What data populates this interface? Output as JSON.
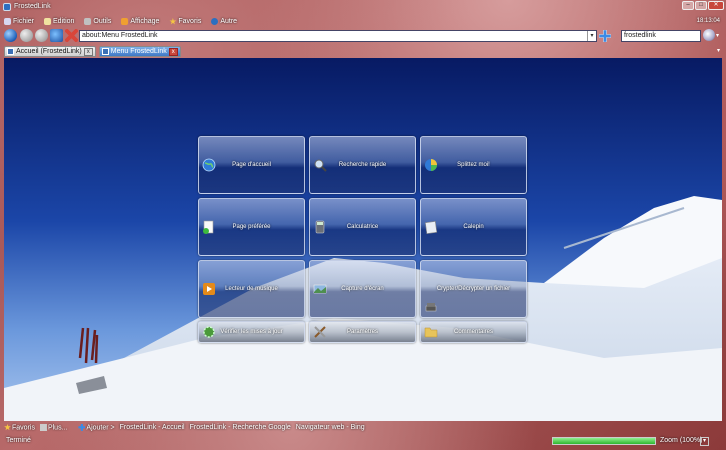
{
  "window": {
    "title": "FrostedLink"
  },
  "window_controls": {
    "minimize": "–",
    "maximize": "□",
    "close": "✕"
  },
  "menu": [
    {
      "label": "Fichier",
      "icon": "file-icon",
      "color": "#d7d7f0"
    },
    {
      "label": "Edition",
      "icon": "edit-icon",
      "color": "#f0e2a0"
    },
    {
      "label": "Outils",
      "icon": "tools-icon",
      "color": "#c0c0c0"
    },
    {
      "label": "Affichage",
      "icon": "view-icon",
      "color": "#f0a030"
    },
    {
      "label": "Favoris",
      "icon": "star-icon",
      "color": "#f5c542"
    },
    {
      "label": "Autre",
      "icon": "help-icon",
      "color": "#2c6fc0"
    }
  ],
  "clock": "18:13:04",
  "address": {
    "value": "about:Menu FrostedLink",
    "dropdown": "▾"
  },
  "search": {
    "value": "frostedlink",
    "dropdown": "▾"
  },
  "tabs": [
    {
      "label": "Accueil (FrostedLink)",
      "close": "x",
      "active": false
    },
    {
      "label": "Menu FrostedLink",
      "close": "x",
      "active": true
    }
  ],
  "tab_menu": "▾",
  "tiles": [
    {
      "label": "Page d'accueil",
      "icon": "globe-icon"
    },
    {
      "label": "Recherche rapide",
      "icon": "magnifier-icon"
    },
    {
      "label": "Splittez moi!",
      "icon": "pie-chart-icon"
    },
    {
      "label": "Page préférée",
      "icon": "document-add-icon"
    },
    {
      "label": "Calculatrice",
      "icon": "calculator-icon"
    },
    {
      "label": "Calepin",
      "icon": "notepad-icon"
    },
    {
      "label": "Lecteur de musique",
      "icon": "media-player-icon"
    },
    {
      "label": "Capture d'écran",
      "icon": "screenshot-icon"
    },
    {
      "label": "Crypter/Décrypter un fichier",
      "icon": "encrypt-icon"
    },
    {
      "label": "Vérifier les mises à jour",
      "icon": "update-gear-icon"
    },
    {
      "label": "Paramètres",
      "icon": "settings-tools-icon"
    },
    {
      "label": "Commentaires",
      "icon": "comment-icon"
    }
  ],
  "bookmarks": {
    "favoris": "Favoris",
    "plus": "Plus...",
    "ajouter": "Ajouter >",
    "items": [
      "FrostedLink - Accueil",
      "FrostedLink - Recherche Google",
      "Navigateur web - Bing"
    ]
  },
  "status": {
    "text": "Terminé",
    "progress": 1.0,
    "zoom": "Zoom (100%)",
    "zoom_control": "▾"
  }
}
